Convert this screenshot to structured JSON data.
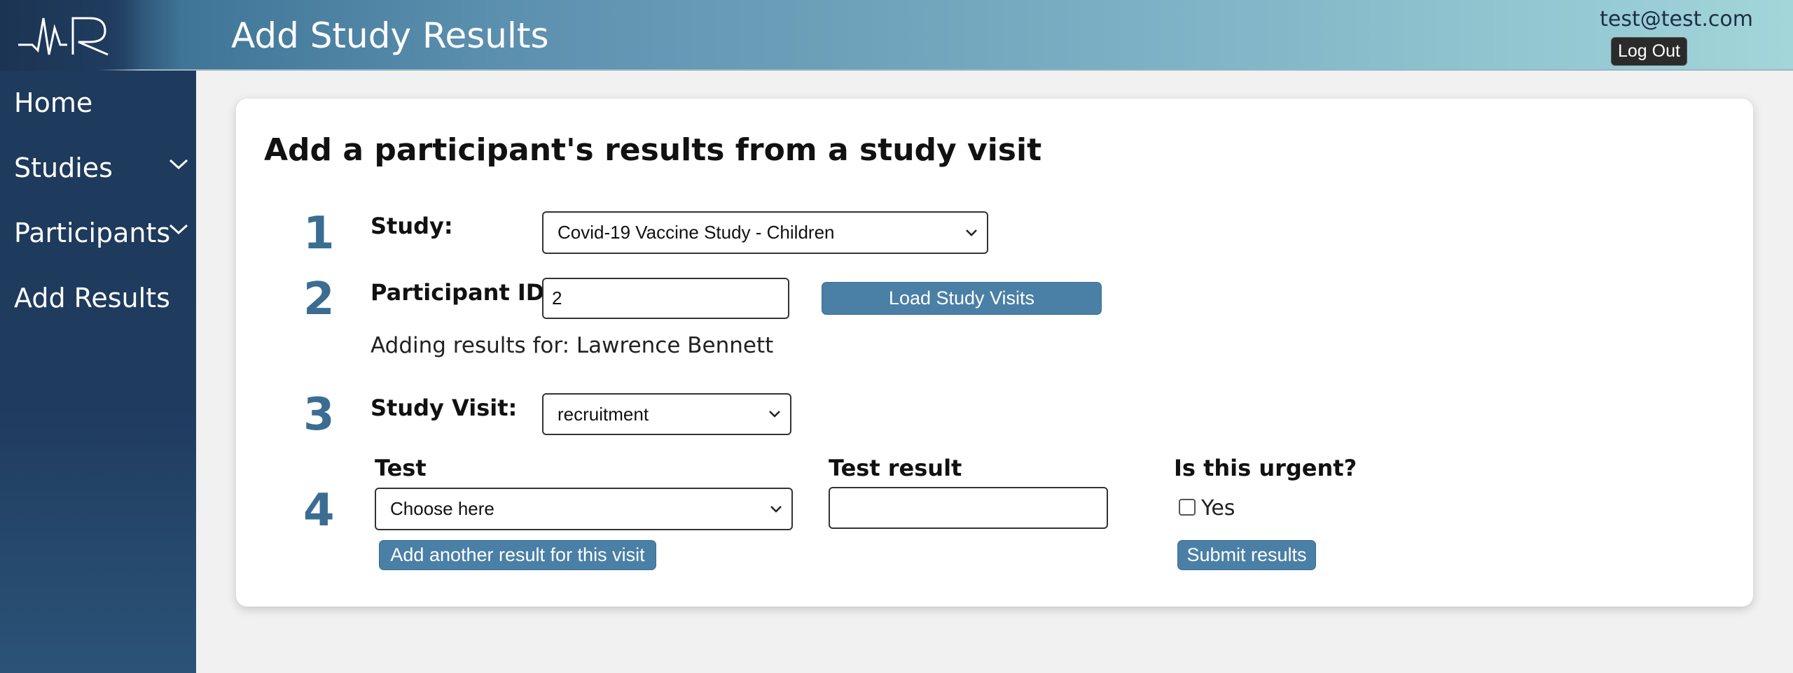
{
  "header": {
    "title": "Add Study Results",
    "user_email": "test@test.com",
    "logout_label": "Log Out"
  },
  "sidebar": {
    "items": [
      {
        "label": "Home",
        "has_submenu": false
      },
      {
        "label": "Studies",
        "has_submenu": true
      },
      {
        "label": "Participants",
        "has_submenu": true
      },
      {
        "label": "Add Results",
        "has_submenu": false
      }
    ]
  },
  "form": {
    "title": "Add a participant's results from a study visit",
    "steps": [
      "1",
      "2",
      "3",
      "4"
    ],
    "study_label": "Study:",
    "study_value": "Covid-19 Vaccine Study - Children",
    "participant_label": "Participant ID:",
    "participant_value": "2",
    "load_visits_label": "Load Study Visits",
    "adding_note": "Adding results for: Lawrence Bennett",
    "visit_label": "Study Visit:",
    "visit_value": "recruitment",
    "test_col_label": "Test",
    "test_value": "Choose here",
    "result_col_label": "Test result",
    "result_value": "",
    "urgent_col_label": "Is this urgent?",
    "urgent_option_label": "Yes",
    "urgent_checked": false,
    "add_another_label": "Add another result for this visit",
    "submit_label": "Submit results"
  },
  "colors": {
    "accent": "#4a7fa6",
    "step_number": "#3b6d92",
    "sidebar": "#1e3a5c"
  }
}
